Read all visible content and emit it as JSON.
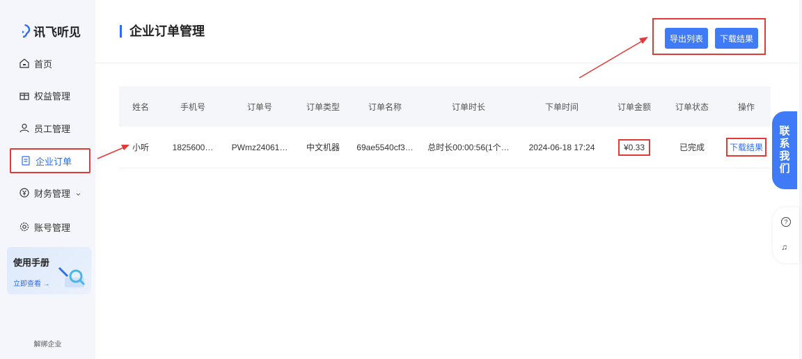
{
  "brand": {
    "name": "讯飞听见",
    "color": "#2f6bf2"
  },
  "sidebar": {
    "items": [
      {
        "label": "首页",
        "icon": "home-icon"
      },
      {
        "label": "权益管理",
        "icon": "gift-icon"
      },
      {
        "label": "员工管理",
        "icon": "user-icon"
      },
      {
        "label": "企业订单",
        "icon": "order-icon",
        "active": true
      },
      {
        "label": "财务管理",
        "icon": "yuan-icon",
        "suffix": "⌄"
      },
      {
        "label": "账号管理",
        "icon": "gear-icon"
      }
    ],
    "manual": {
      "title": "使用手册",
      "link": "立即查看 →"
    },
    "unbind": "解绑企业"
  },
  "header": {
    "title": "企业订单管理",
    "export_label": "导出列表",
    "download_label": "下载结果"
  },
  "table": {
    "columns": [
      "姓名",
      "手机号",
      "订单号",
      "订单类型",
      "订单名称",
      "订单时长",
      "下单时间",
      "订单金额",
      "订单状态",
      "操作"
    ],
    "rows": [
      [
        "小听",
        "1825600…",
        "PWmz24061…",
        "中文机器",
        "69ae5540cf3…",
        "总时长00:00:56(1个…",
        "2024-06-18 17:24",
        "¥0.33",
        "已完成",
        "下载结果"
      ]
    ]
  },
  "float": {
    "contact": [
      "联",
      "系",
      "我",
      "们"
    ],
    "help": "?",
    "service": "♫"
  },
  "accent": "#3f7bf6",
  "highlight": "#e53935"
}
